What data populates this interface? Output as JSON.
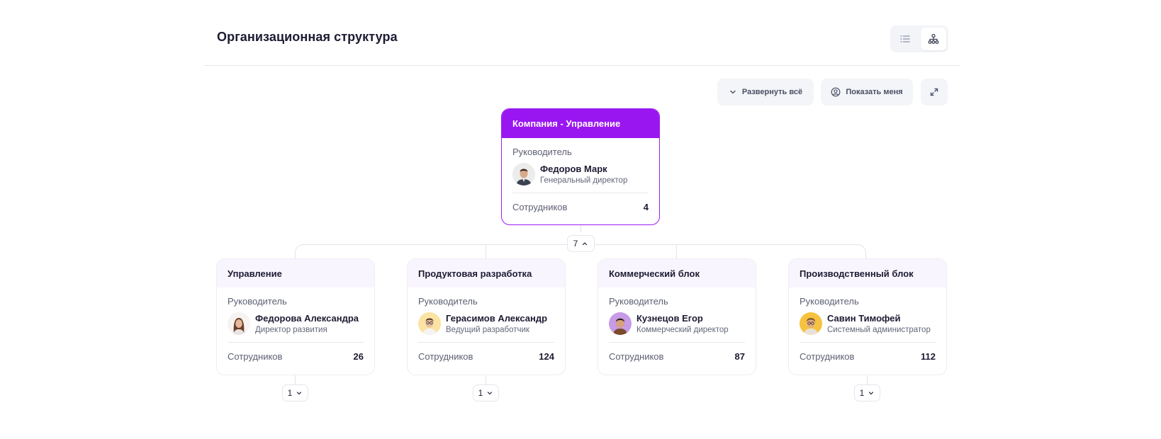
{
  "header": {
    "title": "Организационная структура",
    "views": [
      {
        "icon": "list-icon",
        "active": false
      },
      {
        "icon": "org-tree-icon",
        "active": true
      }
    ]
  },
  "toolbar": {
    "expand_all_label": "Развернуть всё",
    "show_me_label": "Показать меня",
    "fullscreen_icon": "expand-icon"
  },
  "root": {
    "title": "Компания - Управление",
    "manager_label": "Руководитель",
    "manager_name": "Федоров Марк",
    "manager_position": "Генеральный директор",
    "employees_label": "Сотрудников",
    "employees_count": "4",
    "children_count": "7",
    "accent": "#9a16f0"
  },
  "departments": [
    {
      "title": "Управление",
      "manager_label": "Руководитель",
      "manager_name": "Федорова Александра",
      "manager_position": "Директор развития",
      "employees_label": "Сотрудников",
      "employees_count": "26",
      "children_count": "1"
    },
    {
      "title": "Продуктовая разработка",
      "manager_label": "Руководитель",
      "manager_name": "Герасимов Александр",
      "manager_position": "Ведущий разработчик",
      "employees_label": "Сотрудников",
      "employees_count": "124",
      "children_count": "1"
    },
    {
      "title": "Коммерческий блок",
      "manager_label": "Руководитель",
      "manager_name": "Кузнецов Егор",
      "manager_position": "Коммерческий директор",
      "employees_label": "Сотрудников",
      "employees_count": "87"
    },
    {
      "title": "Производственный блок",
      "manager_label": "Руководитель",
      "manager_name": "Савин Тимофей",
      "manager_position": "Системный администратор",
      "employees_label": "Сотрудников",
      "employees_count": "112",
      "children_count": "1"
    }
  ]
}
